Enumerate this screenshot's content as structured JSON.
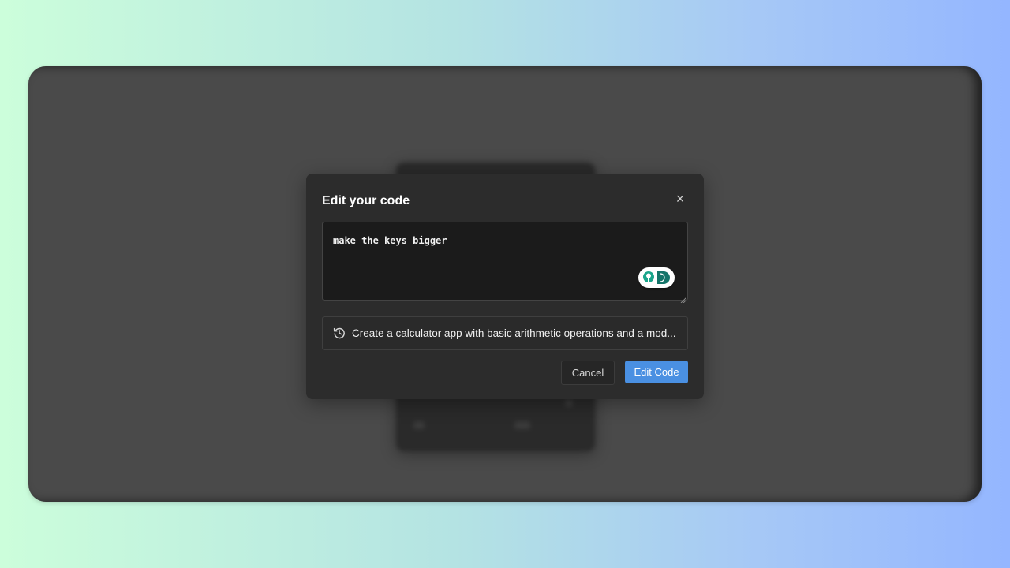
{
  "dialog": {
    "title": "Edit your code",
    "close_label": "×",
    "prompt_value": "make the keys bigger",
    "history_item": "Create a calculator app with basic arithmetic operations and a mod...",
    "cancel_label": "Cancel",
    "submit_label": "Edit Code"
  },
  "colors": {
    "accent": "#4a90e2",
    "badge_green": "#1aa58b",
    "badge_dark": "#15756a"
  }
}
